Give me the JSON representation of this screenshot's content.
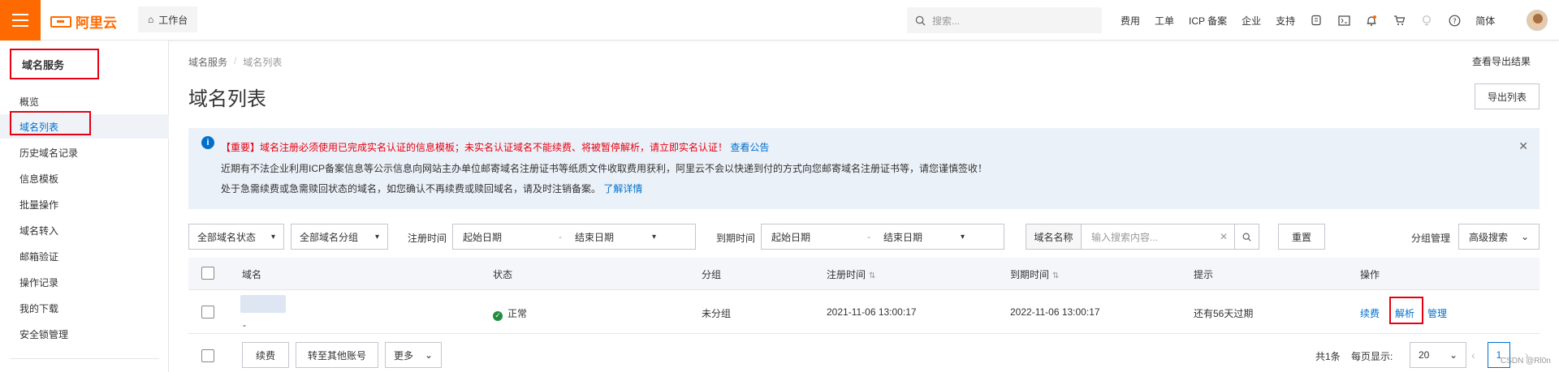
{
  "topbar": {
    "logo_text": "阿里云",
    "workbench": "工作台",
    "search_placeholder": "搜索...",
    "links": [
      "费用",
      "工单",
      "ICP 备案",
      "企业",
      "支持"
    ],
    "lang": "简体",
    "accent": "#ff6a00"
  },
  "sidebar": {
    "title": "域名服务",
    "items": [
      "概览",
      "域名列表",
      "历史域名记录",
      "信息模板",
      "批量操作",
      "域名转入",
      "邮箱验证",
      "操作记录",
      "我的下载",
      "安全锁管理"
    ],
    "active_index": 1
  },
  "main": {
    "breadcrumb": [
      "域名服务",
      "域名列表"
    ],
    "title": "域名列表",
    "view_export": "查看导出结果",
    "export_button": "导出列表"
  },
  "notice": {
    "line1": "【重要】域名注册必须使用已完成实名认证的信息模板；未实名认证域名不能续费、将被暂停解析，请立即实名认证！",
    "line1_link": "查看公告",
    "line2": "近期有不法企业利用ICP备案信息等公示信息向网站主办单位邮寄域名注册证书等纸质文件收取费用获利，阿里云不会以快递到付的方式向您邮寄域名注册证书等，请您谨慎签收！",
    "line3": "处于急需续费或急需赎回状态的域名，如您确认不再续费或赎回域名，请及时注销备案。",
    "line3_link": "了解详情"
  },
  "filters": {
    "status": "全部域名状态",
    "group": "全部域名分组",
    "reg_label": "注册时间",
    "reg_start": "起始日期",
    "reg_end": "结束日期",
    "exp_label": "到期时间",
    "exp_start": "起始日期",
    "exp_end": "结束日期",
    "search_label": "域名名称",
    "search_placeholder": "输入搜索内容...",
    "reset": "重置",
    "group_manage": "分组管理",
    "advanced": "高级搜索"
  },
  "table": {
    "headers": [
      "域名",
      "状态",
      "分组",
      "注册时间",
      "到期时间",
      "提示",
      "操作"
    ],
    "rows": [
      {
        "domain_suffix": "-",
        "status": "正常",
        "group": "未分组",
        "reg_time": "2021-11-06 13:00:17",
        "exp_time": "2022-11-06 13:00:17",
        "hint": "还有56天过期",
        "actions": [
          "续费",
          "解析",
          "管理"
        ]
      }
    ]
  },
  "footer": {
    "renew": "续费",
    "transfer": "转至其他账号",
    "more": "更多",
    "total": "共1条",
    "per_page_label": "每页显示:",
    "per_page": "20",
    "page": "1"
  },
  "watermark": "CSDN @Rl0n"
}
